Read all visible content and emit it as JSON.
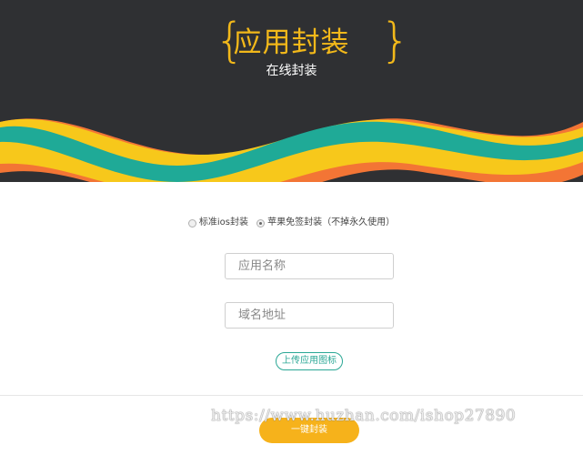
{
  "header": {
    "brace_left": "{",
    "brace_right": "}",
    "title": "应用封装",
    "subtitle": "在线封装"
  },
  "options": [
    {
      "label": "标准ios封装",
      "checked": false
    },
    {
      "label": "苹果免签封装（不掉永久使用）",
      "checked": true
    }
  ],
  "form": {
    "app_name_placeholder": "应用名称",
    "domain_placeholder": "域名地址",
    "upload_label": "上传应用图标",
    "submit_label": "一键封装"
  },
  "watermark": "https://www.huzhan.com/ishop27890",
  "colors": {
    "header_bg": "#2f3033",
    "accent": "#f2b81a",
    "wave_teal": "#1faa97",
    "wave_yellow": "#f7c81b",
    "wave_orange": "#f37535",
    "submit_bg": "#f6b21b"
  }
}
